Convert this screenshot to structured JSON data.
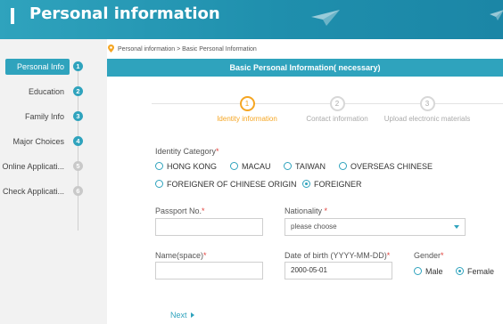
{
  "header": {
    "title": "Personal information"
  },
  "sidebar": {
    "items": [
      {
        "label": "Personal Info",
        "num": "1",
        "active": true
      },
      {
        "label": "Education",
        "num": "2"
      },
      {
        "label": "Family Info",
        "num": "3"
      },
      {
        "label": "Major Choices",
        "num": "4"
      },
      {
        "label": "Online Applicati...",
        "num": "5",
        "disabled": true
      },
      {
        "label": "Check Applicati...",
        "num": "6",
        "disabled": true
      }
    ]
  },
  "breadcrumb": "Personal information > Basic Personal Information",
  "panel": {
    "title": "Basic Personal Information( necessary)"
  },
  "steps": [
    {
      "num": "1",
      "label": "Identity information",
      "active": true
    },
    {
      "num": "2",
      "label": "Contact information"
    },
    {
      "num": "3",
      "label": "Upload electronic materials"
    }
  ],
  "form": {
    "identity_label": "Identity Category",
    "identity_options": [
      "HONG KONG",
      "MACAU",
      "TAIWAN",
      "OVERSEAS CHINESE",
      "FOREIGNER OF CHINESE ORIGIN",
      "FOREIGNER"
    ],
    "identity_selected": "FOREIGNER",
    "passport_label": "Passport No.",
    "passport_value": "",
    "nationality_label": "Nationality",
    "nationality_placeholder": "please choose",
    "name_label": "Name(space)",
    "name_value": "",
    "dob_label": "Date of birth (YYYY-MM-DD)",
    "dob_value": "2000-05-01",
    "gender_label": "Gender",
    "gender_options": [
      "Male",
      "Female"
    ],
    "gender_selected": "Female",
    "required_mark": "*"
  },
  "actions": {
    "next_label": "Next"
  },
  "colors": {
    "accent": "#2fa3bd",
    "step_active": "#f5a623",
    "required": "#e0413c"
  }
}
